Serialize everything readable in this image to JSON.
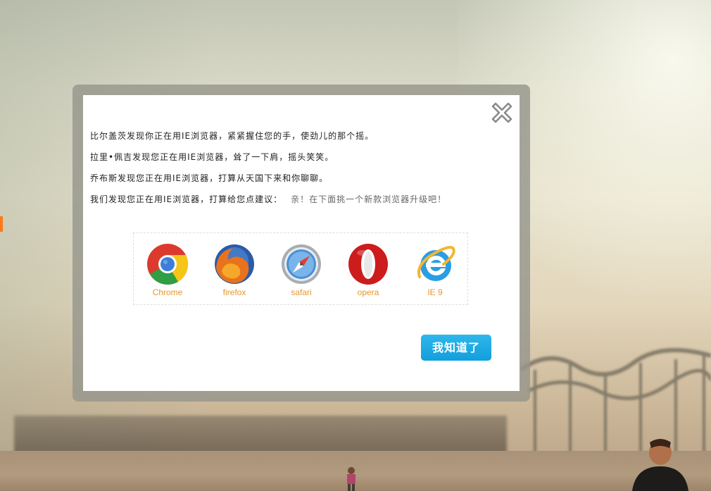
{
  "dialog": {
    "messages": [
      "比尔盖茨发现你正在用IE浏览器，紧紧握住您的手，使劲儿的那个摇。",
      "拉里•佩吉发现您正在用IE浏览器，耸了一下肩，摇头笑笑。",
      "乔布斯发现您正在用IE浏览器，打算从天国下来和你聊聊。",
      "我们发现您正在用IE浏览器，打算给您点建议："
    ],
    "suggestion": "亲！在下面挑一个新款浏览器升级吧！",
    "browsers": [
      {
        "name": "Chrome",
        "icon": "chrome-icon"
      },
      {
        "name": "firefox",
        "icon": "firefox-icon"
      },
      {
        "name": "safari",
        "icon": "safari-icon"
      },
      {
        "name": "opera",
        "icon": "opera-icon"
      },
      {
        "name": "IE 9",
        "icon": "ie-icon"
      }
    ],
    "confirm_label": "我知道了",
    "close_icon": "close-icon"
  },
  "colors": {
    "browser_label": "#e8962a",
    "button": "#1aa7e2",
    "side_marker": "#ff7a1a"
  }
}
